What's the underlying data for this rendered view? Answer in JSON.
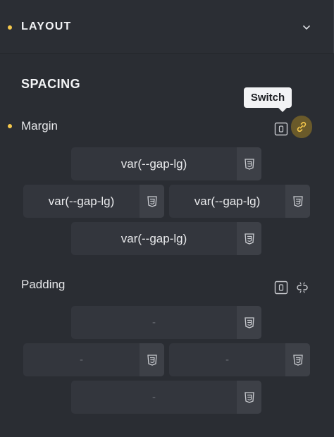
{
  "header": {
    "title": "LAYOUT",
    "chevron_icon": "chevron-down-icon"
  },
  "section": {
    "title": "SPACING"
  },
  "tooltip": {
    "text": "Switch"
  },
  "margin": {
    "label": "Margin",
    "top": "var(--gap-lg)",
    "left": "var(--gap-lg)",
    "right": "var(--gap-lg)",
    "bottom": "var(--gap-lg)"
  },
  "padding": {
    "label": "Padding",
    "top": "-",
    "left": "-",
    "right": "-",
    "bottom": "-"
  },
  "colors": {
    "accent": "#f5c84c",
    "panel": "#2a2d33",
    "field": "#33363d"
  }
}
